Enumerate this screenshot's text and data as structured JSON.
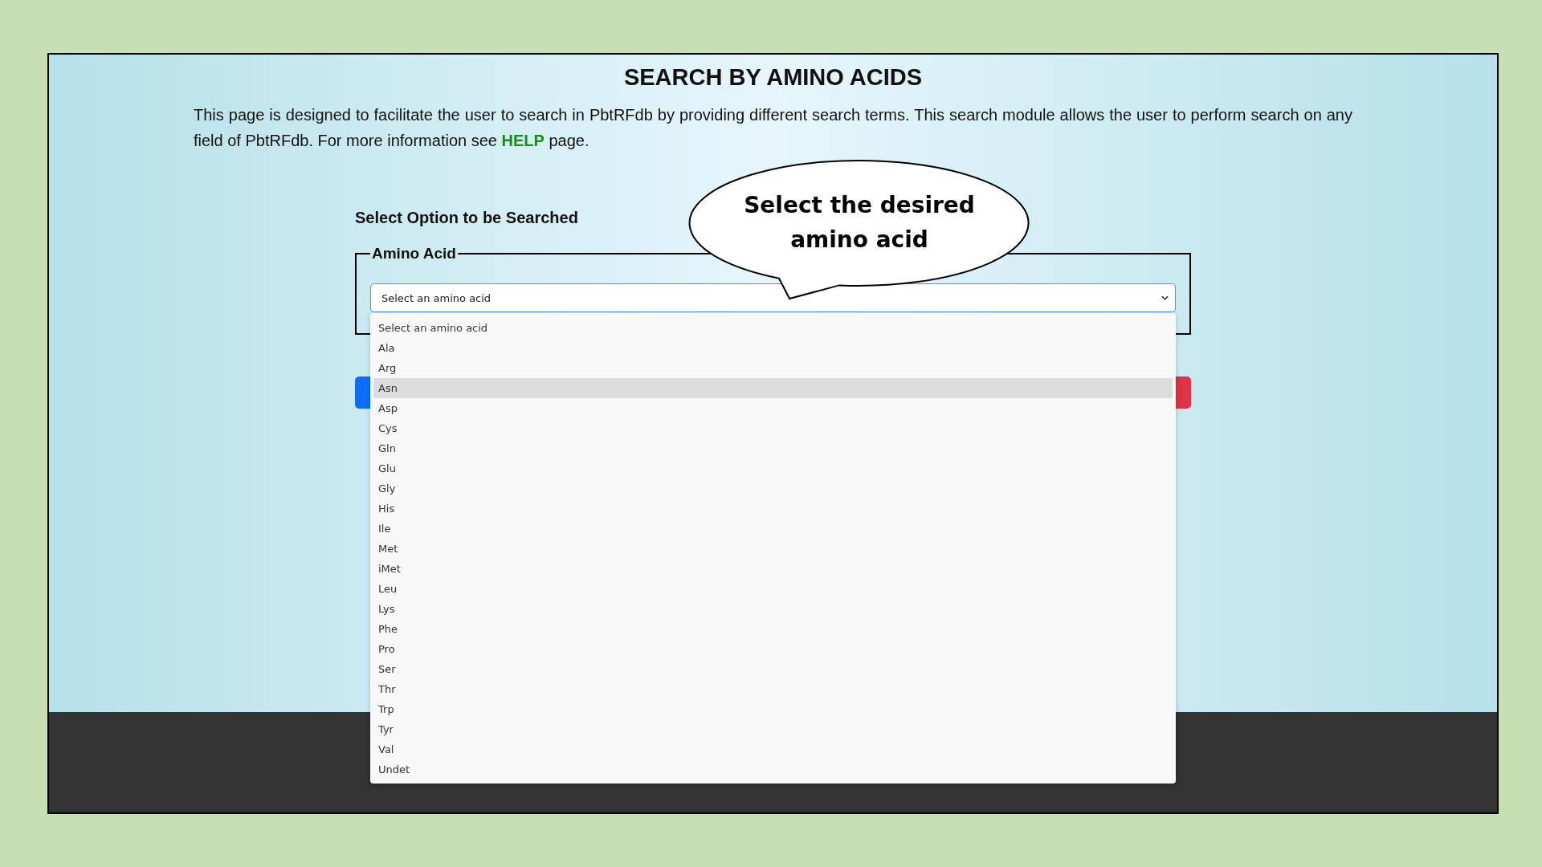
{
  "page": {
    "title": "SEARCH BY AMINO ACIDS",
    "intro": "This page is designed to facilitate the user to search in PbtRFdb by providing different search terms. This search module allows the user to perform search on any field of PbtRFdb. For more information see",
    "help_link": "HELP",
    "intro_end": "page."
  },
  "form": {
    "heading": "Select Option to be Searched",
    "legend": "Amino Acid",
    "select_value": "Select an amino acid",
    "options": [
      {
        "label": "Select an amino acid",
        "selected": false
      },
      {
        "label": "Ala",
        "selected": false
      },
      {
        "label": "Arg",
        "selected": false
      },
      {
        "label": "Asn",
        "selected": true
      },
      {
        "label": "Asp",
        "selected": false
      },
      {
        "label": "Cys",
        "selected": false
      },
      {
        "label": "Gln",
        "selected": false
      },
      {
        "label": "Glu",
        "selected": false
      },
      {
        "label": "Gly",
        "selected": false
      },
      {
        "label": "His",
        "selected": false
      },
      {
        "label": "Ile",
        "selected": false
      },
      {
        "label": "Met",
        "selected": false
      },
      {
        "label": "iMet",
        "selected": false
      },
      {
        "label": "Leu",
        "selected": false
      },
      {
        "label": "Lys",
        "selected": false
      },
      {
        "label": "Phe",
        "selected": false
      },
      {
        "label": "Pro",
        "selected": false
      },
      {
        "label": "Ser",
        "selected": false
      },
      {
        "label": "Thr",
        "selected": false
      },
      {
        "label": "Trp",
        "selected": false
      },
      {
        "label": "Tyr",
        "selected": false
      },
      {
        "label": "Val",
        "selected": false
      },
      {
        "label": "Undet",
        "selected": false
      }
    ]
  },
  "callout": {
    "text": "Select the desired amino acid"
  }
}
